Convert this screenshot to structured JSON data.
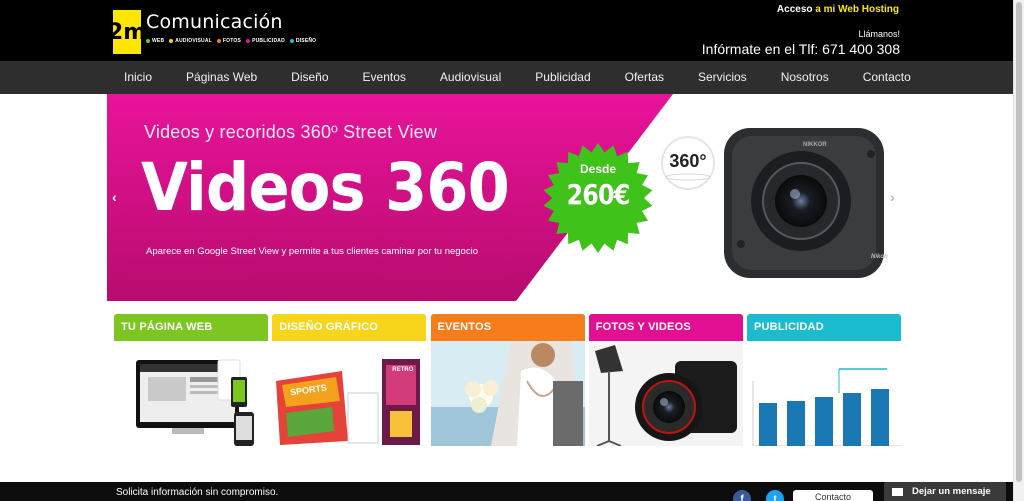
{
  "header": {
    "logo_mark": "2m",
    "logo_name": "Comunicación",
    "logo_tags": [
      "WEB",
      "AUDIOVISUAL",
      "FOTOS",
      "PUBLICIDAD",
      "DISEÑO"
    ],
    "access_prefix": "Acceso ",
    "access_link": "a mi Web Hosting",
    "call_label": "Llámanos!",
    "phone_text": "Infórmate en el Tlf: 671 400 308"
  },
  "nav": {
    "items": [
      "Inicio",
      "Páginas Web",
      "Diseño",
      "Eventos",
      "Audiovisual",
      "Publicidad",
      "Ofertas",
      "Servicios",
      "Nosotros",
      "Contacto"
    ]
  },
  "hero": {
    "subtitle": "Videos y recoridos 360º Street View",
    "title": "Videos 360",
    "description": "Aparece en Google Street View y permite a tus clientes caminar por tu negocio",
    "badge_from": "Desde",
    "badge_price": "260€",
    "camera_badge": "360°",
    "camera_brand_top": "NIKKOR",
    "camera_brand_bottom": "Nikon",
    "arrow_left": "‹",
    "arrow_right": "›"
  },
  "cards": [
    {
      "label": "TU PÁGINA WEB",
      "color": "#7dc520",
      "icon": "web-devices-image"
    },
    {
      "label": "DISEÑO GRÁFICO",
      "color": "#f6d51a",
      "icon": "graphic-design-image"
    },
    {
      "label": "EVENTOS",
      "color": "#f67c1c",
      "icon": "wedding-image"
    },
    {
      "label": "FOTOS Y VIDEOS",
      "color": "#e20f93",
      "icon": "camera-image"
    },
    {
      "label": "PUBLICIDAD",
      "color": "#1bbcd0",
      "icon": "bar-chart-image"
    }
  ],
  "card_images": {
    "graphic_design_words": [
      "SPORTS",
      "RETRO"
    ]
  },
  "footer": {
    "request_text": "Solicita información sin compromiso.",
    "contact_button": "Contacto",
    "facebook_glyph": "f",
    "twitter_glyph": "t",
    "message_label": "Dejar un mensaje"
  },
  "colors": {
    "accent_yellow": "#ffe600",
    "hero_magenta": "#e20f93",
    "badge_green": "#3fc21a"
  }
}
